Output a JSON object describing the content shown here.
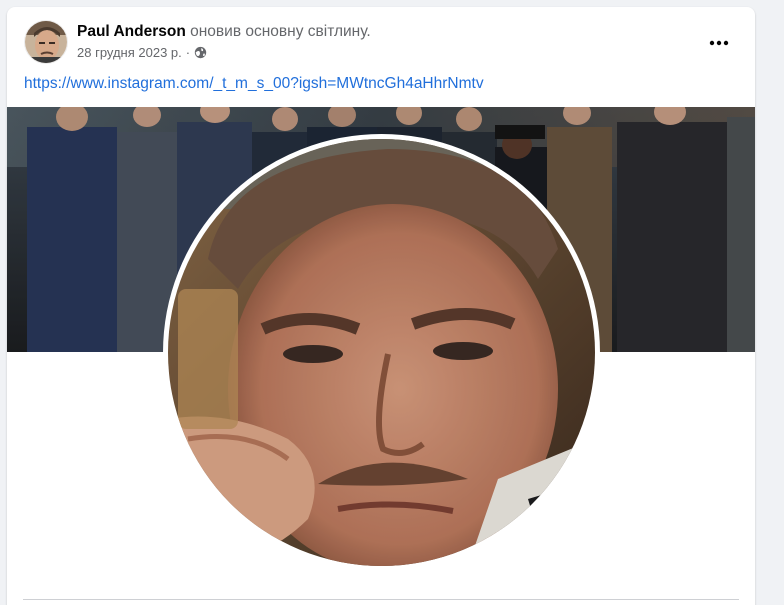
{
  "post": {
    "author_name": "Paul Anderson",
    "action_text": "оновив основну світлину.",
    "date": "28 грудня 2023 р.",
    "separator": "·",
    "privacy_icon": "globe-icon",
    "more_icon": "more-horizontal-icon",
    "link_text": "https://www.instagram.com/_t_m_s_00?igsh=MWtncGh4aHhrNmtv"
  },
  "colors": {
    "page_background": "#f0f2f5",
    "card_background": "#ffffff",
    "link": "#216fdb",
    "primary_text": "#050505",
    "secondary_text": "#65676b"
  }
}
